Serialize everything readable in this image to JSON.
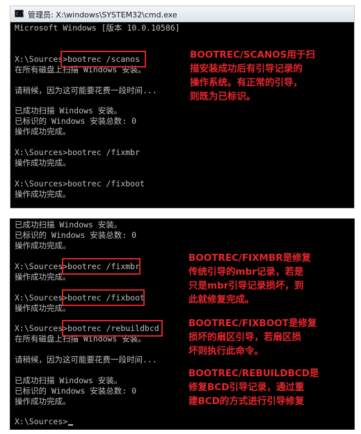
{
  "window": {
    "title": "管理员: X:\\windows\\SYSTEM32\\cmd.exe",
    "icon": "cmd-icon"
  },
  "panel1": {
    "lines": [
      "Microsoft Windows [版本 10.0.10586]",
      "X:\\Sources>bootrec /scanos",
      "在所有磁盘上扫描 Windows 安装。",
      "请稍候，因为这可能要花费一段时间...",
      "已成功扫描 Windows 安装。",
      "已标识的 Windows 安装总数: 0",
      "操作成功完成。",
      "X:\\Sources>bootrec /fixmbr",
      "操作成功完成。",
      "X:\\Sources>bootrec /fixboot",
      "操作成功完成。"
    ],
    "annotation": "BOOTREC/SCANOS用于扫\n描安装成功后有引导记录的\n操作系统。有正常的引导，\n则既为已标识。"
  },
  "panel2": {
    "lines": [
      "已成功扫描 Windows 安装。",
      "已标识的 Windows 安装总数: 0",
      "操作成功完成。",
      "X:\\Sources>bootrec /fixmbr",
      "操作成功完成。",
      "X:\\Sources>bootrec /fixboot",
      "操作成功完成。",
      "X:\\Sources>bootrec /rebuildbcd",
      "在所有磁盘上扫描 Windows 安装。",
      "请稍候，因为这可能要花费一段时间...",
      "已成功扫描 Windows 安装。",
      "已标识的 Windows 安装总数: 0",
      "操作成功完成。",
      "X:\\Sources>"
    ],
    "annotation_fixmbr": "BOOTREC/FIXMBR是修复\n传统引导的mbr记录，若是\n只是mbr引导记录损坏，到\n此就修复完成。",
    "annotation_fixboot": "BOOTREC/FIXBOOT是修复\n损坏的扇区引导，若扇区损\n坏则执行此命令。",
    "annotation_rebuildbcd": "BOOTREC/REBUILDBCD是\n修复BCD引导记录，通过重\n建BCD的方式进行引导修复"
  },
  "colors": {
    "console_bg": "#000000",
    "console_text": "#c0c0c0",
    "highlight_red": "#e0242a"
  }
}
